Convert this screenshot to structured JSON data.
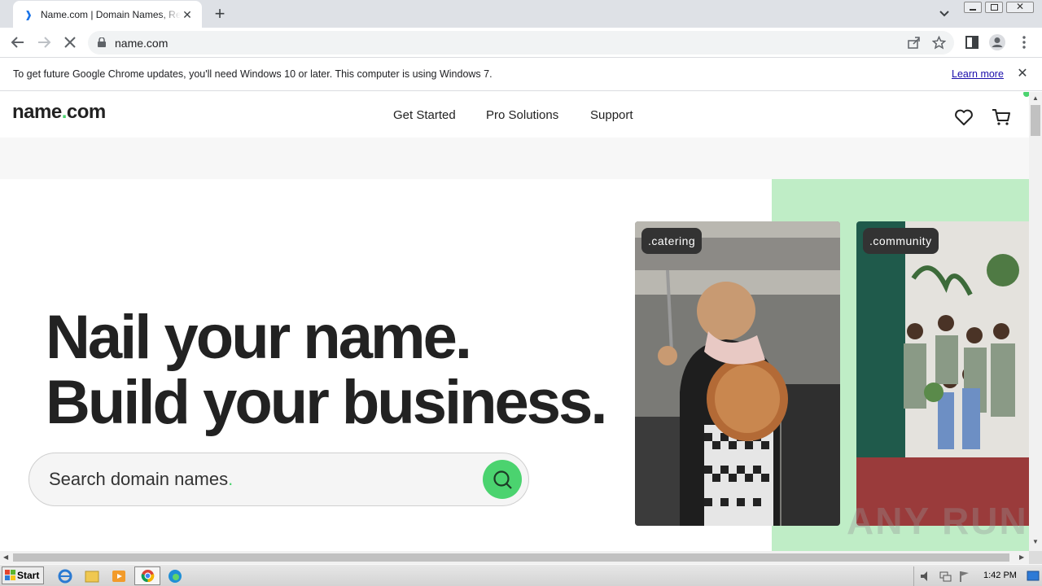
{
  "browser": {
    "tab_title": "Name.com | Domain Names, Registration",
    "new_tab": "+",
    "url": "name.com",
    "infobar": {
      "message": "To get future Google Chrome updates, you'll need Windows 10 or later. This computer is using Windows 7.",
      "link": "Learn more"
    }
  },
  "site": {
    "logo": {
      "main": "name",
      "dot": ".",
      "tld": "com"
    },
    "nav": [
      "Get Started",
      "Pro Solutions",
      "Support"
    ],
    "headline": [
      "Nail your name.",
      "Build your business."
    ],
    "search": {
      "placeholder": "Search domain names",
      "dot": "."
    },
    "photo_tags": [
      ".catering",
      ".community"
    ],
    "accent_color": "#4bd36f",
    "hero_green": "#bfedc6"
  },
  "watermark": "ANY RUN",
  "taskbar": {
    "start": "Start",
    "clock": "1:42 PM"
  }
}
